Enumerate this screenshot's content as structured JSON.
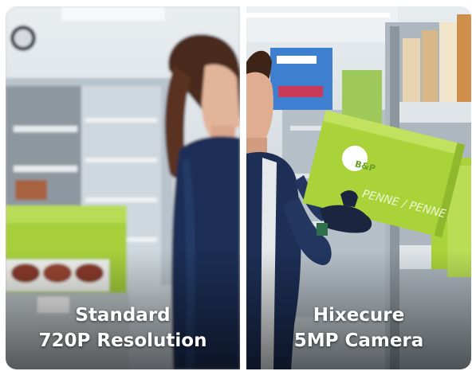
{
  "left_panel": {
    "caption_line1": "Standard",
    "caption_line2": "720P Resolution",
    "image_quality": "blurred"
  },
  "right_panel": {
    "caption_line1": "Hixecure",
    "caption_line2": "5MP Camera",
    "box_logo": "B&P",
    "box_text": "PENNE / PENNE",
    "image_quality": "sharp"
  },
  "colors": {
    "uniform_navy": "#1d2f55",
    "box_green": "#a9d339",
    "caption_text": "#ffffff"
  }
}
